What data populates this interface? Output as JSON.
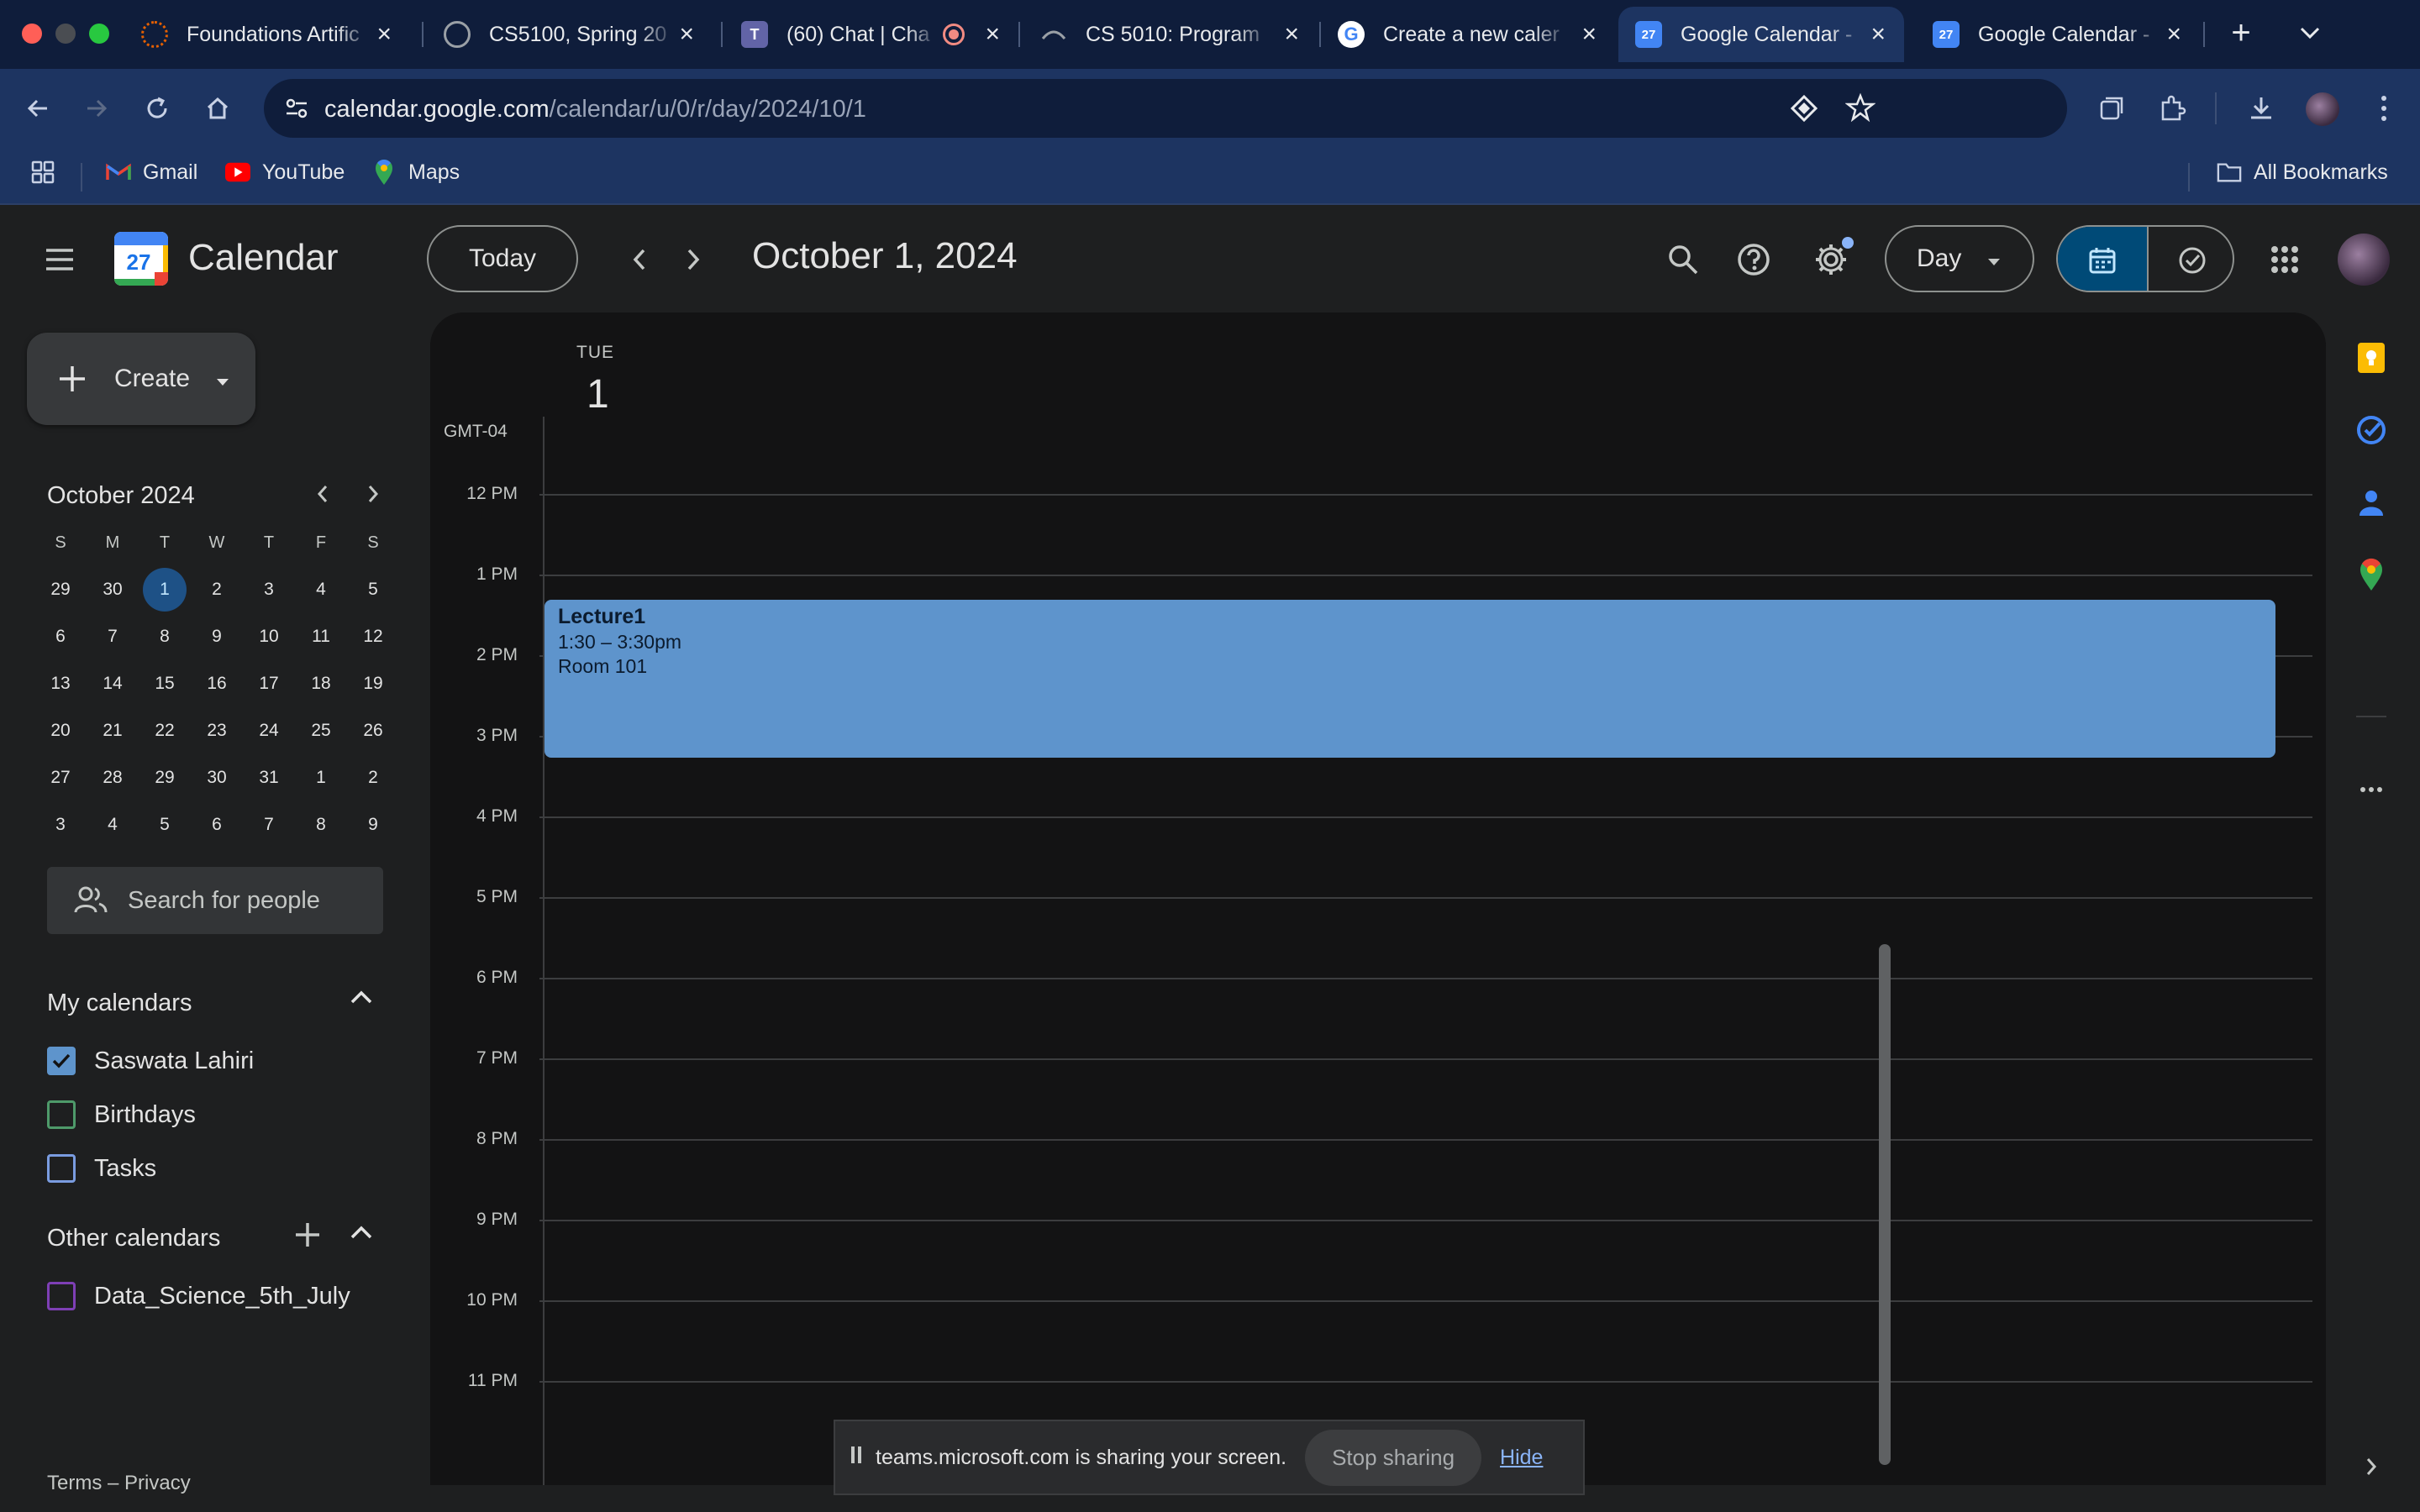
{
  "browser": {
    "tabs": [
      {
        "title": "Foundations Artific",
        "icon": "canvas-icon",
        "color": "#e66000"
      },
      {
        "title": "CS5100, Spring 20",
        "icon": "globe-icon",
        "color": "#9aa0a6"
      },
      {
        "title": "(60) Chat | Cha",
        "icon": "teams-icon",
        "color": "#6264a7"
      },
      {
        "title": "CS 5010: Program",
        "icon": "edx-icon",
        "color": "#9aa0a6"
      },
      {
        "title": "Create a new caler",
        "icon": "google-icon",
        "color": "#4285f4"
      },
      {
        "title": "Google Calendar -",
        "icon": "calendar-icon",
        "color": "#4285f4"
      },
      {
        "title": "Google Calendar -",
        "icon": "calendar-icon",
        "color": "#4285f4"
      }
    ],
    "active_tab": 5,
    "url_host": "calendar.google.com",
    "url_path": "/calendar/u/0/r/day/2024/10/1",
    "bookmarks": [
      {
        "label": "Gmail"
      },
      {
        "label": "YouTube"
      },
      {
        "label": "Maps"
      }
    ],
    "all_bookmarks": "All Bookmarks"
  },
  "app": {
    "name": "Calendar",
    "logo_day": "27",
    "today_label": "Today",
    "date_title": "October 1, 2024",
    "view_label": "Day",
    "create_label": "Create"
  },
  "minical": {
    "title": "October 2024",
    "dow": [
      "S",
      "M",
      "T",
      "W",
      "T",
      "F",
      "S"
    ],
    "weeks": [
      [
        "29",
        "30",
        "1",
        "2",
        "3",
        "4",
        "5"
      ],
      [
        "6",
        "7",
        "8",
        "9",
        "10",
        "11",
        "12"
      ],
      [
        "13",
        "14",
        "15",
        "16",
        "17",
        "18",
        "19"
      ],
      [
        "20",
        "21",
        "22",
        "23",
        "24",
        "25",
        "26"
      ],
      [
        "27",
        "28",
        "29",
        "30",
        "31",
        "1",
        "2"
      ],
      [
        "3",
        "4",
        "5",
        "6",
        "7",
        "8",
        "9"
      ]
    ],
    "today": "1"
  },
  "search_people_placeholder": "Search for people",
  "my_calendars": {
    "title": "My calendars",
    "items": [
      {
        "label": "Saswata Lahiri",
        "checked": true,
        "color": "#5e94cc"
      },
      {
        "label": "Birthdays",
        "checked": false,
        "color": "#4e9a6a"
      },
      {
        "label": "Tasks",
        "checked": false,
        "color": "#7a9ce0"
      }
    ]
  },
  "other_calendars": {
    "title": "Other calendars",
    "items": [
      {
        "label": "Data_Science_5th_July",
        "checked": false,
        "color": "#7e3fb5"
      }
    ]
  },
  "footer": "Terms – Privacy",
  "day_view": {
    "dow": "TUE",
    "day": "1",
    "timezone": "GMT-04",
    "hours": [
      "12 PM",
      "1 PM",
      "2 PM",
      "3 PM",
      "4 PM",
      "5 PM",
      "6 PM",
      "7 PM",
      "8 PM",
      "9 PM",
      "10 PM",
      "11 PM"
    ],
    "event": {
      "title": "Lecture1",
      "time": "1:30 – 3:30pm",
      "location": "Room 101",
      "color": "#5e94cc"
    }
  },
  "share_banner": {
    "text": "teams.microsoft.com is sharing your screen.",
    "stop": "Stop sharing",
    "hide": "Hide"
  }
}
